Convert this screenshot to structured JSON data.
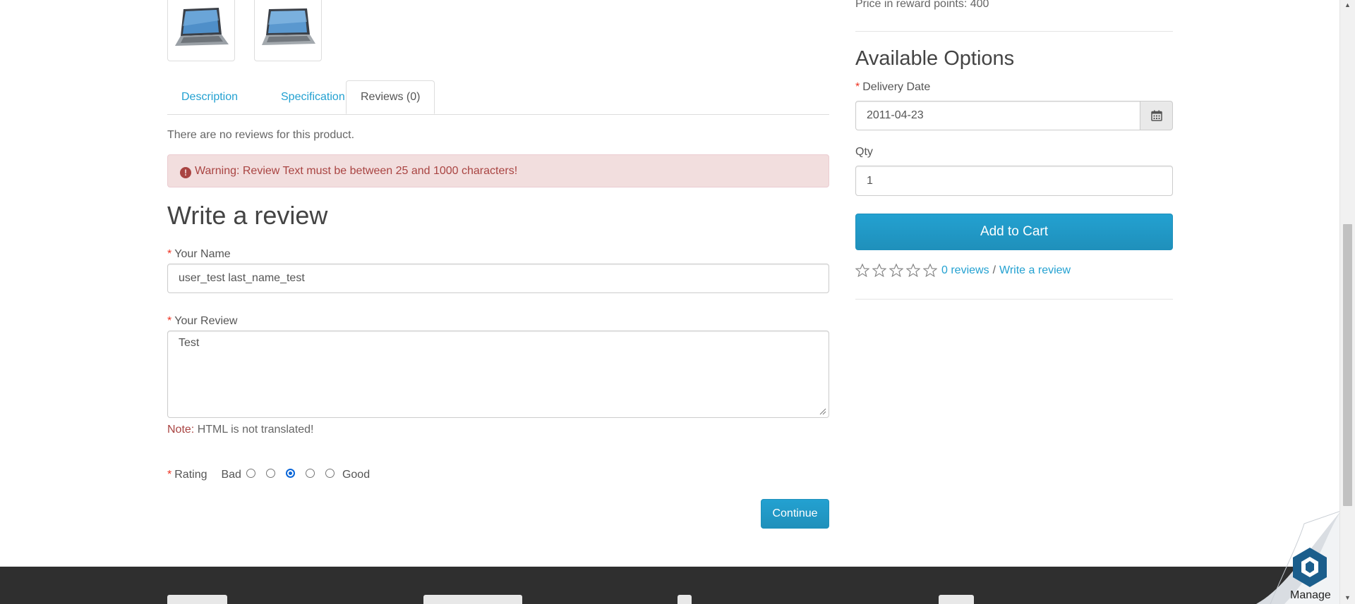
{
  "product": {
    "reward_points_text": "Price in reward points: 400"
  },
  "tabs": [
    {
      "label": "Description"
    },
    {
      "label": "Specification"
    },
    {
      "label": "Reviews (0)"
    }
  ],
  "reviews": {
    "empty_text": "There are no reviews for this product.",
    "warning": "Warning: Review Text must be between 25 and 1000 characters!",
    "heading": "Write a review",
    "name_label": "Your Name",
    "name_value": "user_test last_name_test",
    "review_label": "Your Review",
    "review_value": "Test",
    "note_label": "Note:",
    "note_text": " HTML is not translated!",
    "rating_label": "Rating",
    "rating_bad": "Bad",
    "rating_good": "Good",
    "rating_selected": 3,
    "continue_label": "Continue"
  },
  "options": {
    "heading": "Available Options",
    "delivery_label": "Delivery Date",
    "delivery_value": "2011-04-23",
    "qty_label": "Qty",
    "qty_value": "1",
    "add_to_cart": "Add to Cart",
    "reviews_link": "0 reviews",
    "separator": "/",
    "write_review_link": "Write a review"
  },
  "manage": {
    "label": "Manage"
  },
  "colors": {
    "accent": "#23a1d1",
    "alert_bg": "#f2dede",
    "alert_text": "#a94442",
    "footer": "#2f2f2f"
  }
}
